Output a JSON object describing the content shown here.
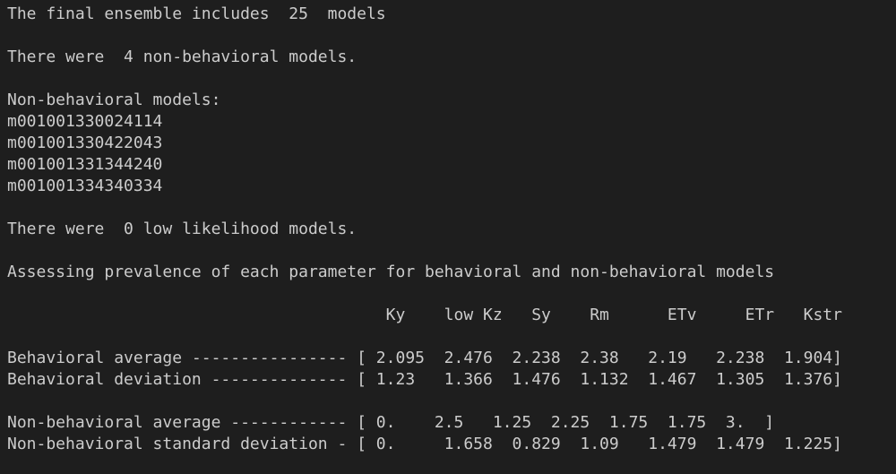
{
  "output": {
    "ensemble_line": "The final ensemble includes  25  models",
    "nonbehavioral_count_line": "There were  4 non-behavioral models.",
    "nonbehavioral_header": "Non-behavioral models:",
    "nonbehavioral_models": [
      "m001001330024114",
      "m001001330422043",
      "m001001331344240",
      "m001001334340334"
    ],
    "low_likelihood_line": "There were  0 low likelihood models.",
    "assessing_line": "Assessing prevalence of each parameter for behavioral and non-behavioral models",
    "table": {
      "header": "                                       Ky    low Kz   Sy    Rm      ETv     ETr   Kstr",
      "rows_group1": [
        "Behavioral average ---------------- [ 2.095  2.476  2.238  2.38   2.19   2.238  1.904]",
        "Behavioral deviation -------------- [ 1.23   1.366  1.476  1.132  1.467  1.305  1.376]"
      ],
      "rows_group2": [
        "Non-behavioral average ------------ [ 0.    2.5   1.25  2.25  1.75  1.75  3.  ]",
        "Non-behavioral standard deviation - [ 0.     1.658  0.829  1.09   1.479  1.479  1.225]"
      ]
    }
  }
}
